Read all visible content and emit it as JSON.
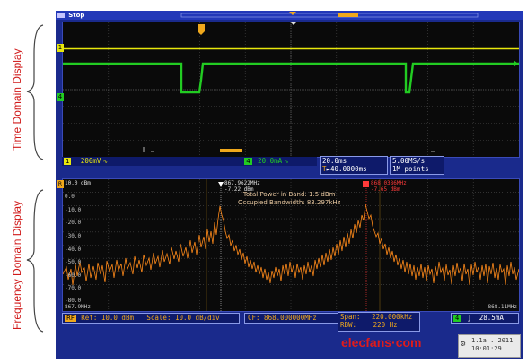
{
  "labels": {
    "time_domain": "Time Domain Display",
    "frequency_domain": "Frequency Domain Display"
  },
  "status": {
    "run_state": "Stop"
  },
  "time_display": {
    "ch1_scale": "200mV",
    "ch4_scale": "20.0mA",
    "timebase": "20.0ms",
    "trigger_pos": "►40.0000ms",
    "sample_rate": "5.00MS/s",
    "record_length": "1M points"
  },
  "freq_display": {
    "ref_level_label": "Ref: 10.0 dBm",
    "scale_label": "Scale: 10.0 dB/div",
    "cf_label": "CF: 868.000000MHz",
    "span_label": "Span:",
    "span_value": "220.000kHz",
    "rbw_label": "RBW:",
    "rbw_value": "220 Hz",
    "ch4_readout": "28.5mA",
    "top_left_level": "10.0 dBm",
    "y_ticks": [
      "10.0 dBm",
      "0.0",
      "-10.0",
      "-20.0",
      "-30.0",
      "-40.0",
      "-50.0",
      "-60.0",
      "-70.0",
      "-80.0"
    ],
    "x_start": "867.9MHz",
    "x_stop": "868.11MHz",
    "marker1": {
      "freq": "867.9622MHz",
      "level": "-7.22 dBm"
    },
    "marker2": {
      "freq": "868.0386MHz",
      "level": "-7.65 dBm"
    },
    "measurement_power": "Total Power in Band: 1.5 dBm",
    "measurement_bw": "Occupied Bandwidth: 83.297kHz"
  },
  "footer": {
    "watermark": "elecfans·com",
    "date": "1.1a . 2011",
    "time": "10:01:29"
  },
  "colors": {
    "ch1": "#e8e80c",
    "ch4": "#22cc22",
    "spectrum": "#ff8a1a",
    "frame": "#1a2a8c",
    "label": "#d01a1a"
  }
}
